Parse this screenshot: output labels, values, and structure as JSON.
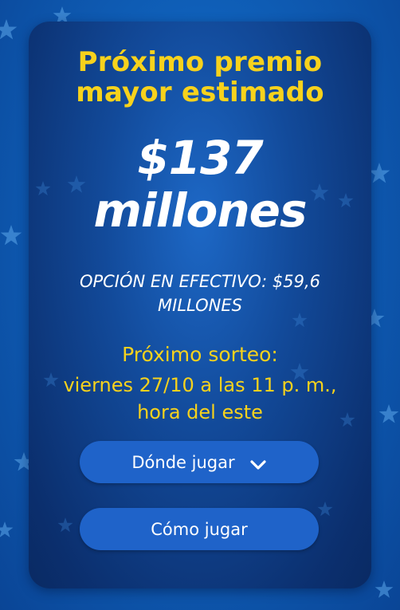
{
  "jackpot": {
    "title_line1": "Próximo premio",
    "title_line2": "mayor estimado",
    "amount_line1": "$137",
    "amount_line2": "millones",
    "cash_option_line1": "OPCIÓN EN EFECTIVO: $59,6",
    "cash_option_line2": "MILLONES"
  },
  "next_draw": {
    "label": "Próximo sorteo:",
    "date_line1": "viernes 27/10 a las 11 p. m.,",
    "date_line2": "hora del este"
  },
  "buttons": {
    "where_to_play": "Dónde jugar",
    "how_to_play": "Cómo jugar"
  },
  "icons": {
    "where_to_play": "chevron-down-icon",
    "background": "star-icon"
  },
  "colors": {
    "accent_yellow": "#f7d21c",
    "button_blue": "#1f63c9",
    "card_blue": "#124a9a",
    "background_blue": "#0f5fb8"
  }
}
